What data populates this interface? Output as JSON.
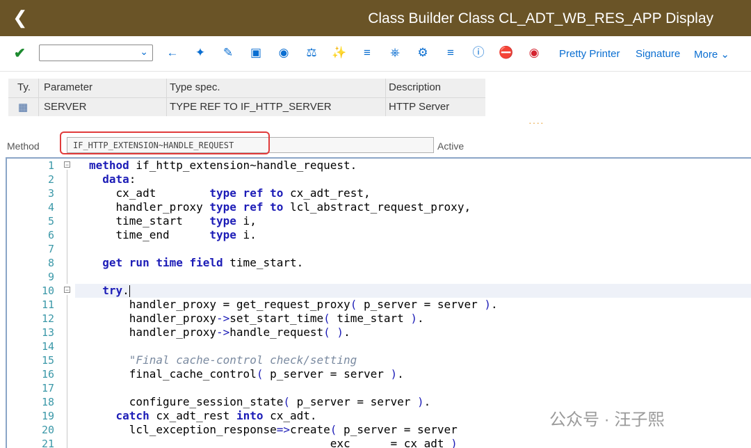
{
  "header": {
    "back_icon": "chevron-left-icon",
    "title": "Class Builder Class CL_ADT_WB_RES_APP Display"
  },
  "toolbar": {
    "combo_value": "",
    "icons": [
      "check-icon",
      "back-arrow-icon",
      "other-object-icon",
      "display-change-icon",
      "activate-icon",
      "check-syntax-icon",
      "where-used-icon",
      "balance-icon",
      "magic-wand-icon",
      "filter-icon",
      "hierarchy-icon",
      "tree-icon",
      "indent-icon",
      "info-icon",
      "stop-icon",
      "record-icon"
    ],
    "pretty_printer": "Pretty Printer",
    "signature": "Signature",
    "more": "More"
  },
  "params_grid": {
    "headers": [
      "Ty.",
      "Parameter",
      "Type spec.",
      "Description"
    ],
    "rows": [
      {
        "type_icon": "importing-icon",
        "parameter": "SERVER",
        "type_spec": "TYPE REF TO IF_HTTP_SERVER",
        "description": "HTTP Server"
      }
    ]
  },
  "method": {
    "label": "Method",
    "value": "IF_HTTP_EXTENSION~HANDLE_REQUEST",
    "status": "Active"
  },
  "code_lines": [
    "1",
    "2",
    "3",
    "4",
    "5",
    "6",
    "7",
    "8",
    "9",
    "10",
    "11",
    "12",
    "13",
    "14",
    "15",
    "16",
    "17",
    "18",
    "19",
    "20",
    "21"
  ],
  "colors": {
    "header_bg": "#6a5427",
    "accent": "#0a6ed1",
    "keyword": "#1d1db7",
    "line_number": "#3b98a8",
    "highlight_box": "#e03a3a"
  },
  "watermark": "公众号 · 汪子熙"
}
